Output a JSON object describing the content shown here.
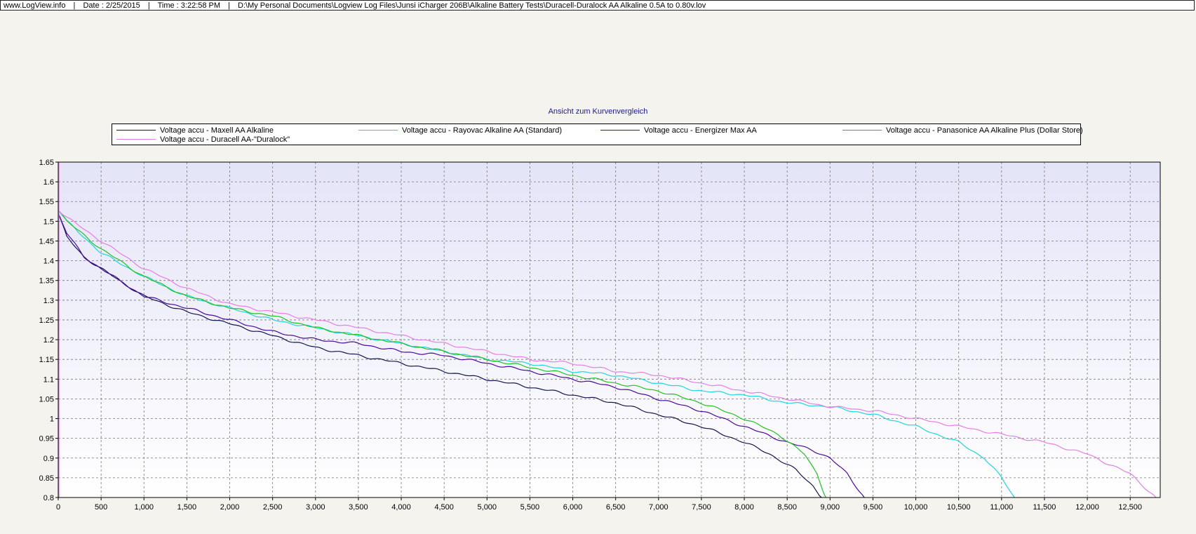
{
  "header": {
    "site": "www.LogView.info",
    "date": "Date : 2/25/2015",
    "time": "Time : 3:22:58 PM",
    "path": "D:\\My Personal Documents\\Logview Log Files\\Junsi iCharger 206B\\Alkaline Battery Tests\\Duracell-Duralock AA Alkaline 0.5A to 0.80v.lov"
  },
  "chart_data": {
    "type": "line",
    "title": "Ansicht zum Kurvenvergleich",
    "xlabel": "",
    "ylabel": "",
    "xlim": [
      0,
      12850
    ],
    "ylim": [
      0.8,
      1.65
    ],
    "x_ticks": [
      0,
      500,
      1000,
      1500,
      2000,
      2500,
      3000,
      3500,
      4000,
      4500,
      5000,
      5500,
      6000,
      6500,
      7000,
      7500,
      8000,
      8500,
      9000,
      9500,
      10000,
      10500,
      11000,
      11500,
      12000,
      12500
    ],
    "x_tick_labels": [
      "0",
      "500",
      "1,000",
      "1,500",
      "2,000",
      "2,500",
      "3,000",
      "3,500",
      "4,000",
      "4,500",
      "5,000",
      "5,500",
      "6,000",
      "6,500",
      "7,000",
      "7,500",
      "8,000",
      "8,500",
      "9,000",
      "9,500",
      "10,000",
      "10,500",
      "11,000",
      "11,500",
      "12,000",
      "12,500"
    ],
    "y_ticks": [
      0.8,
      0.85,
      0.9,
      0.95,
      1,
      1.05,
      1.1,
      1.15,
      1.2,
      1.25,
      1.3,
      1.35,
      1.4,
      1.45,
      1.5,
      1.55,
      1.6,
      1.65
    ],
    "y_tick_labels": [
      "0.8",
      "0.85",
      "0.9",
      "0.95",
      "1",
      "1.05",
      "1.1",
      "1.15",
      "1.2",
      "1.25",
      "1.3",
      "1.35",
      "1.4",
      "1.45",
      "1.5",
      "1.55",
      "1.6",
      "1.65"
    ],
    "grid": true,
    "legend_position": "top",
    "series": [
      {
        "name": "Voltage accu - Maxell AA Alkaline",
        "color": "#141450",
        "x": [
          0,
          100,
          300,
          500,
          1000,
          1500,
          2000,
          2500,
          3000,
          3500,
          4000,
          4500,
          5000,
          5500,
          6000,
          6500,
          7000,
          7500,
          8000,
          8300,
          8600,
          8800,
          8900
        ],
        "y": [
          1.52,
          1.46,
          1.41,
          1.38,
          1.31,
          1.27,
          1.24,
          1.21,
          1.18,
          1.16,
          1.14,
          1.12,
          1.1,
          1.08,
          1.06,
          1.04,
          1.01,
          0.98,
          0.94,
          0.91,
          0.87,
          0.83,
          0.8
        ]
      },
      {
        "name": "Voltage accu - Rayovac Alkaline AA (Standard)",
        "color": "#22d4dc",
        "x": [
          0,
          100,
          500,
          1000,
          1500,
          2000,
          2500,
          3000,
          3500,
          4000,
          4500,
          5000,
          5500,
          6000,
          6500,
          7000,
          7500,
          8000,
          8500,
          9000,
          9500,
          10000,
          10500,
          10800,
          11000,
          11150
        ],
        "y": [
          1.53,
          1.5,
          1.42,
          1.36,
          1.31,
          1.28,
          1.25,
          1.23,
          1.21,
          1.19,
          1.17,
          1.15,
          1.14,
          1.12,
          1.11,
          1.09,
          1.07,
          1.06,
          1.04,
          1.03,
          1.01,
          0.98,
          0.94,
          0.9,
          0.85,
          0.8
        ]
      },
      {
        "name": "Voltage accu - Energizer Max AA",
        "color": "#4a0a9a",
        "x": [
          0,
          100,
          300,
          500,
          1000,
          1500,
          2000,
          2500,
          3000,
          3500,
          4000,
          4500,
          5000,
          5500,
          6000,
          6500,
          7000,
          7500,
          8000,
          8500,
          8800,
          9000,
          9200,
          9400
        ],
        "y": [
          1.52,
          1.47,
          1.41,
          1.38,
          1.31,
          1.28,
          1.25,
          1.22,
          1.2,
          1.19,
          1.17,
          1.16,
          1.14,
          1.12,
          1.1,
          1.08,
          1.05,
          1.02,
          0.98,
          0.94,
          0.92,
          0.9,
          0.86,
          0.8
        ]
      },
      {
        "name": "Voltage accu - Panasonice AA Alkaline Plus (Dollar Store)",
        "color": "#22c022",
        "x": [
          0,
          100,
          500,
          1000,
          1500,
          2000,
          2500,
          3000,
          3500,
          4000,
          4500,
          5000,
          5500,
          6000,
          6500,
          7000,
          7500,
          8000,
          8400,
          8700,
          8850,
          8950
        ],
        "y": [
          1.53,
          1.5,
          1.43,
          1.36,
          1.31,
          1.28,
          1.26,
          1.23,
          1.21,
          1.19,
          1.17,
          1.15,
          1.13,
          1.11,
          1.09,
          1.07,
          1.04,
          1.0,
          0.96,
          0.91,
          0.86,
          0.8
        ]
      },
      {
        "name": "Voltage accu - Duracell AA-\"Duralock\"",
        "color": "#e67ee6",
        "x": [
          0,
          100,
          500,
          1000,
          1500,
          2000,
          2500,
          3000,
          3500,
          4000,
          4500,
          5000,
          5500,
          6000,
          6500,
          7000,
          7500,
          8000,
          8500,
          9000,
          9500,
          10000,
          10500,
          11000,
          11500,
          12000,
          12500,
          12800
        ],
        "y": [
          1.53,
          1.51,
          1.45,
          1.38,
          1.33,
          1.29,
          1.27,
          1.25,
          1.23,
          1.21,
          1.19,
          1.17,
          1.15,
          1.14,
          1.12,
          1.11,
          1.09,
          1.07,
          1.05,
          1.03,
          1.02,
          1.0,
          0.98,
          0.96,
          0.94,
          0.91,
          0.86,
          0.8
        ]
      }
    ]
  }
}
